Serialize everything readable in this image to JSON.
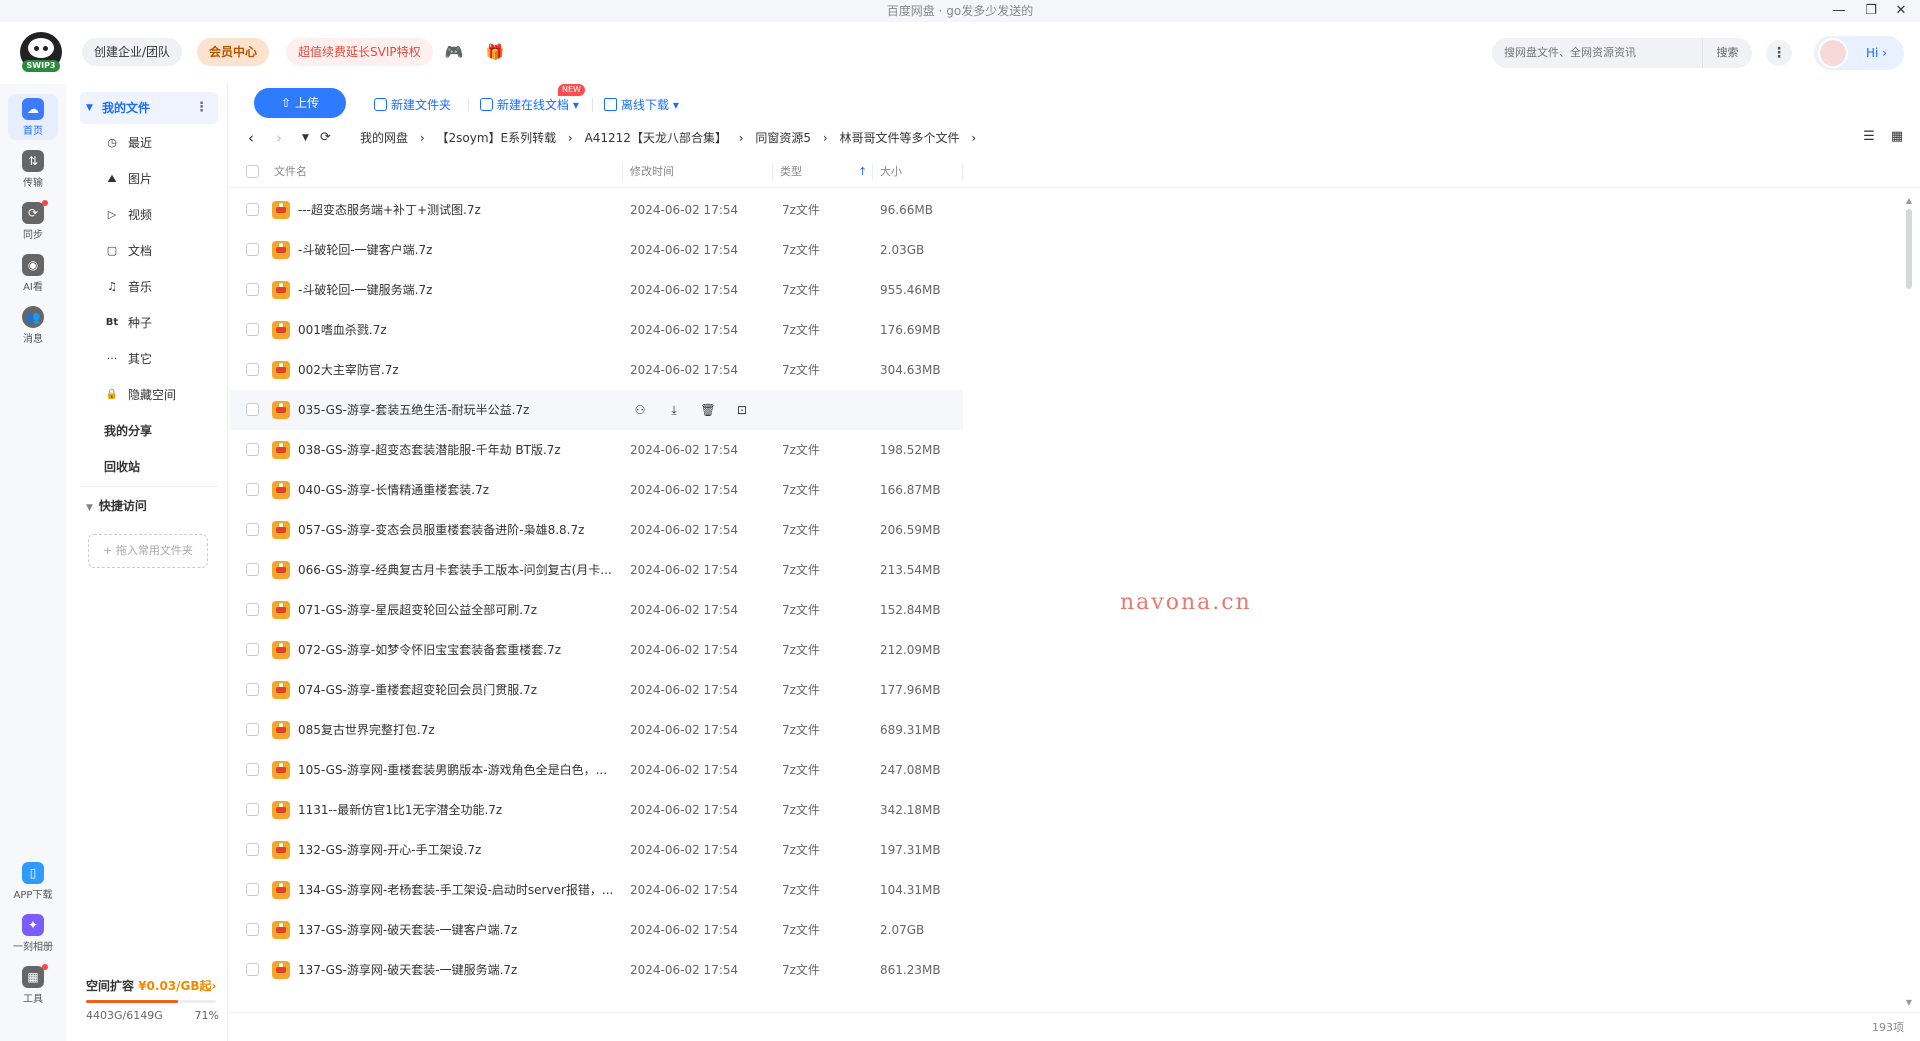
{
  "window": {
    "title": "百度网盘 · go发多少发送的"
  },
  "header": {
    "logo_text": "SWIP3",
    "create_team": "创建企业/团队",
    "vip_center": "会员中心",
    "svip_promo": "超值续费延长SVIP特权",
    "search_placeholder": "搜网盘文件、全网资源资讯",
    "search_button": "搜索",
    "greeting": "Hi"
  },
  "rail": {
    "items": [
      {
        "label": "首页",
        "icon": "cloud-icon"
      },
      {
        "label": "传输",
        "icon": "transfer-icon"
      },
      {
        "label": "同步",
        "icon": "sync-icon"
      },
      {
        "label": "AI看",
        "icon": "ai-icon"
      },
      {
        "label": "消息",
        "icon": "message-icon"
      },
      {
        "label": "APP下载",
        "icon": "phone-icon"
      },
      {
        "label": "一刻相册",
        "icon": "album-icon"
      },
      {
        "label": "工具",
        "icon": "tools-icon"
      }
    ]
  },
  "sidebar": {
    "my_files": "我的文件",
    "items": [
      {
        "label": "最近",
        "glyph": "◷"
      },
      {
        "label": "图片",
        "glyph": "⛰"
      },
      {
        "label": "视频",
        "glyph": "▷"
      },
      {
        "label": "文档",
        "glyph": "▢"
      },
      {
        "label": "音乐",
        "glyph": "♫"
      },
      {
        "label": "种子",
        "glyph": "Bt"
      },
      {
        "label": "其它",
        "glyph": "···"
      },
      {
        "label": "隐藏空间",
        "glyph": "🔒"
      }
    ],
    "my_share": "我的分享",
    "recycle": "回收站",
    "quick_access": "快捷访问",
    "quick_add": "+ 拖入常用文件夹",
    "storage": {
      "title": "空间扩容",
      "price": "¥0.03/GB起",
      "usage": "4403G/6149G",
      "percent_label": "71%",
      "percent": 71
    }
  },
  "toolbar": {
    "upload": "上传",
    "new_folder": "新建文件夹",
    "new_online_doc": "新建在线文档",
    "new_tag": "NEW",
    "offline_download": "离线下载"
  },
  "breadcrumb": [
    "我的网盘",
    "【2soym】E系列转载",
    "A41212【天龙八部合集】",
    "同窗资源5",
    "林哥哥文件等多个文件"
  ],
  "table": {
    "headers": {
      "name": "文件名",
      "modified": "修改时间",
      "type": "类型",
      "size": "大小"
    },
    "rows": [
      {
        "name": "---超变态服务端+补丁+测试图.7z",
        "date": "2024-06-02 17:54",
        "type": "7z文件",
        "size": "96.66MB"
      },
      {
        "name": "-斗破轮回-一键客户端.7z",
        "date": "2024-06-02 17:54",
        "type": "7z文件",
        "size": "2.03GB"
      },
      {
        "name": "-斗破轮回-一键服务端.7z",
        "date": "2024-06-02 17:54",
        "type": "7z文件",
        "size": "955.46MB"
      },
      {
        "name": "001嗜血杀戮.7z",
        "date": "2024-06-02 17:54",
        "type": "7z文件",
        "size": "176.69MB"
      },
      {
        "name": "002大主宰防官.7z",
        "date": "2024-06-02 17:54",
        "type": "7z文件",
        "size": "304.63MB"
      },
      {
        "name": "035-GS-游享-套装五绝生活-耐玩半公益.7z",
        "date": "",
        "type": "",
        "size": ""
      },
      {
        "name": "038-GS-游享-超变态套装潜能服-千年劫 BT版.7z",
        "date": "2024-06-02 17:54",
        "type": "7z文件",
        "size": "198.52MB"
      },
      {
        "name": "040-GS-游享-长情精通重楼套装.7z",
        "date": "2024-06-02 17:54",
        "type": "7z文件",
        "size": "166.87MB"
      },
      {
        "name": "057-GS-游享-变态会员服重楼套装备进阶-枭雄8.8.7z",
        "date": "2024-06-02 17:54",
        "type": "7z文件",
        "size": "206.59MB"
      },
      {
        "name": "066-GS-游享-经典复古月卡套装手工版本-问剑复古(月卡...",
        "date": "2024-06-02 17:54",
        "type": "7z文件",
        "size": "213.54MB"
      },
      {
        "name": "071-GS-游享-星辰超变轮回公益全部可刷.7z",
        "date": "2024-06-02 17:54",
        "type": "7z文件",
        "size": "152.84MB"
      },
      {
        "name": "072-GS-游享-如梦令怀旧宝宝套装备套重楼套.7z",
        "date": "2024-06-02 17:54",
        "type": "7z文件",
        "size": "212.09MB"
      },
      {
        "name": "074-GS-游享-重楼套超变轮回会员门贯服.7z",
        "date": "2024-06-02 17:54",
        "type": "7z文件",
        "size": "177.96MB"
      },
      {
        "name": "085复古世界完整打包.7z",
        "date": "2024-06-02 17:54",
        "type": "7z文件",
        "size": "689.31MB"
      },
      {
        "name": "105-GS-游享网-重楼套装男鹏版本-游戏角色全是白色，...",
        "date": "2024-06-02 17:54",
        "type": "7z文件",
        "size": "247.08MB"
      },
      {
        "name": "1131--最新仿官1比1无字潜全功能.7z",
        "date": "2024-06-02 17:54",
        "type": "7z文件",
        "size": "342.18MB"
      },
      {
        "name": "132-GS-游享网-开心-手工架设.7z",
        "date": "2024-06-02 17:54",
        "type": "7z文件",
        "size": "197.31MB"
      },
      {
        "name": "134-GS-游享网-老杨套装-手工架设-启动时server报错，...",
        "date": "2024-06-02 17:54",
        "type": "7z文件",
        "size": "104.31MB"
      },
      {
        "name": "137-GS-游享网-破天套装-一键客户端.7z",
        "date": "2024-06-02 17:54",
        "type": "7z文件",
        "size": "2.07GB"
      },
      {
        "name": "137-GS-游享网-破天套装-一键服务端.7z",
        "date": "2024-06-02 17:54",
        "type": "7z文件",
        "size": "861.23MB"
      }
    ]
  },
  "watermark": "navona.cn",
  "footer": {
    "count": "193项"
  }
}
